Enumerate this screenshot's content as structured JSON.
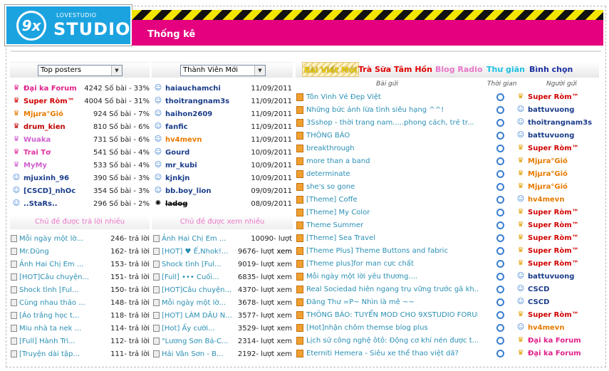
{
  "header": {
    "logo_small": "LOVESTUDIO",
    "logo_big": "STUDIO",
    "logo_mark": "9x",
    "title": "Thống kê"
  },
  "posters": {
    "select": "Top posters",
    "rows": [
      {
        "name": "Đại ka Forum",
        "stat": "4242 Số bài - 33%",
        "color": "#e0218a",
        "icon": "crown-icon"
      },
      {
        "name": "Super Ròm™",
        "stat": "4004 Số bài - 31%",
        "color": "#d10000",
        "icon": "crown-icon"
      },
      {
        "name": "Mjµra°Gió",
        "stat": "924 Số bài - 7%",
        "color": "#e87a00",
        "icon": "crown-icon"
      },
      {
        "name": "drum_kien",
        "stat": "810 Số bài - 6%",
        "color": "#c00000",
        "icon": "crown-icon"
      },
      {
        "name": "Wuaka",
        "stat": "731 Số bài - 6%",
        "color": "#d060d0",
        "icon": "crown-icon"
      },
      {
        "name": "Trai Tơ",
        "stat": "541 Số bài - 4%",
        "color": "#e030a0",
        "icon": "crown-icon"
      },
      {
        "name": "MyMy",
        "stat": "533 Số bài - 4%",
        "color": "#d060d0",
        "icon": "crown-icon"
      },
      {
        "name": "mjuxinh_96",
        "stat": "390 Số bài - 3%",
        "color": "#1a3c8a",
        "icon": "user-icon"
      },
      {
        "name": "[CSCD]_nhOc",
        "stat": "354 Số bài - 3%",
        "color": "#1a3c8a",
        "icon": "user-icon"
      },
      {
        "name": "..StaRs..",
        "stat": "296 Số bài - 2%",
        "color": "#1a3c8a",
        "icon": "user-icon"
      }
    ]
  },
  "members": {
    "select": "Thành Viên Mới",
    "rows": [
      {
        "name": "haiauchamchi",
        "date": "11/09/2011",
        "color": "#1a3c8a"
      },
      {
        "name": "thoitrangnam3s",
        "date": "11/09/2011",
        "color": "#1a3c8a"
      },
      {
        "name": "haihon2609",
        "date": "11/09/2011",
        "color": "#1a3c8a"
      },
      {
        "name": "fanfic",
        "date": "11/09/2011",
        "color": "#1a3c8a"
      },
      {
        "name": "hv4mevn",
        "date": "11/09/2011",
        "color": "#e87a00"
      },
      {
        "name": "Gourd",
        "date": "10/09/2011",
        "color": "#1a3c8a"
      },
      {
        "name": "mr_kubi",
        "date": "10/09/2011",
        "color": "#1a3c8a"
      },
      {
        "name": "kjnkjn",
        "date": "10/09/2011",
        "color": "#1a3c8a"
      },
      {
        "name": "bb.boy_lion",
        "date": "09/09/2011",
        "color": "#1a3c8a"
      },
      {
        "name": "ladog",
        "date": "08/09/2011",
        "color": "#000000"
      }
    ]
  },
  "replied": {
    "title": "Chủ đề được trả lời nhiều",
    "rows": [
      {
        "t": "Mỗi ngày một lờ...",
        "n": "246- trả lời"
      },
      {
        "t": "Mr.Dũng",
        "n": "162- trả lời"
      },
      {
        "t": "Ảnh Hai Chị Em ...",
        "n": "153- trả lời"
      },
      {
        "t": "[HOT]Câu chuyện...",
        "n": "151- trả lời"
      },
      {
        "t": "Shock tình [Ful...",
        "n": "150- trả lời"
      },
      {
        "t": "Cùng nhau thảo ...",
        "n": "148- trả lời"
      },
      {
        "t": "[Áo trắng học t...",
        "n": "118- trả lời"
      },
      {
        "t": "Miu nhà ta nek ...",
        "n": "114- trả lời"
      },
      {
        "t": "[Full] Hành Trì...",
        "n": "112- trả lời"
      },
      {
        "t": "[Truyện dài tập...",
        "n": "111- trả lời"
      }
    ]
  },
  "viewed": {
    "title": "Chủ đề được xem nhiều",
    "rows": [
      {
        "t": "Ảnh Hai Chị Em ...",
        "n": "10090- lượt xem"
      },
      {
        "t": "[HOT] ♥ Ế,Nhok!...",
        "n": "9676- lượt xem"
      },
      {
        "t": "Shock tình [Ful...",
        "n": "9019- lượt xem"
      },
      {
        "t": "[Full] ••• Cuối...",
        "n": "6835- lượt xem"
      },
      {
        "t": "[HOT]Câu chuyện...",
        "n": "4370- lượt xem"
      },
      {
        "t": "Mỗi ngày một lờ...",
        "n": "3678- lượt xem"
      },
      {
        "t": "[HOT] LÀM DÂU N...",
        "n": "3577- lượt xem"
      },
      {
        "t": "[Hot] Ấy cười...",
        "n": "3529- lượt xem"
      },
      {
        "t": "\"Lương Sơn Bá-C...",
        "n": "2314- lượt xem"
      },
      {
        "t": "Hải Vân Sơn - B...",
        "n": "2192- lượt xem"
      }
    ]
  },
  "tabs": [
    {
      "label": "Bài Viết Mới",
      "color": "#f2d000"
    },
    {
      "label": "Trà Sữa Tâm Hồn",
      "color": "#e00000"
    },
    {
      "label": "Blog Radio",
      "color": "#e876c7"
    },
    {
      "label": "Thư giãn",
      "color": "#1ec0e0"
    },
    {
      "label": "Bình chọn",
      "color": "#1a2ea0"
    }
  ],
  "columns": {
    "post": "Bài gửi",
    "time": "Thời gian",
    "poster": "Người gửi"
  },
  "posts": [
    {
      "t": "Tôn Vinh Vẻ Đẹp Việt",
      "u": "Super Ròm™",
      "uc": "#d10000",
      "crown": true
    },
    {
      "t": "Những bức ảnh lừa tình siêu hạng ^^!",
      "u": "battuvuong",
      "uc": "#1a3c8a",
      "crown": false
    },
    {
      "t": "3Sshop - thời trang nam.....phong cách, trẻ tr...",
      "u": "thoitrangnam3s",
      "uc": "#1a3c8a",
      "crown": false
    },
    {
      "t": "THÔNG BÁO",
      "u": "battuvuong",
      "uc": "#1a3c8a",
      "crown": false
    },
    {
      "t": "breakthrough",
      "u": "Super Ròm™",
      "uc": "#d10000",
      "crown": true
    },
    {
      "t": "more than a band",
      "u": "Mjµra°Gió",
      "uc": "#e87a00",
      "crown": true
    },
    {
      "t": "determinate",
      "u": "Mjµra°Gió",
      "uc": "#e87a00",
      "crown": true
    },
    {
      "t": "she's so gone",
      "u": "Mjµra°Gió",
      "uc": "#e87a00",
      "crown": true
    },
    {
      "t": "[Theme] Coffe",
      "u": "hv4mevn",
      "uc": "#e87a00",
      "crown": false
    },
    {
      "t": "[Theme] My Color",
      "u": "Super Ròm™",
      "uc": "#d10000",
      "crown": true
    },
    {
      "t": "Theme Summer",
      "u": "Super Ròm™",
      "uc": "#d10000",
      "crown": true
    },
    {
      "t": "[Theme] Sea Travel",
      "u": "Super Ròm™",
      "uc": "#d10000",
      "crown": true
    },
    {
      "t": "[Theme Plus] Theme Buttons and fabric",
      "u": "Super Ròm™",
      "uc": "#d10000",
      "crown": true
    },
    {
      "t": "[Theme plus]for man cực chất",
      "u": "Super Ròm™",
      "uc": "#d10000",
      "crown": true
    },
    {
      "t": "Mỗi ngày một lời yêu thương....",
      "u": "battuvuong",
      "uc": "#1a3c8a",
      "crown": false
    },
    {
      "t": "Real Sociedad hiên ngang trụ vững trước gã kh...",
      "u": "CSCD",
      "uc": "#1a3c8a",
      "crown": false
    },
    {
      "t": "Đăng Thư =P~ Nhìn là mê ~~",
      "u": "CSCD",
      "uc": "#1a3c8a",
      "crown": false
    },
    {
      "t": "THÔNG BÁO: TUYỂN MOD CHO 9XSTUDIO FORUM",
      "u": "Super Ròm™",
      "uc": "#d10000",
      "crown": true
    },
    {
      "t": "[Hot]nhận chôm themse blog plus",
      "u": "hv4mevn",
      "uc": "#e87a00",
      "crown": false
    },
    {
      "t": "Lịch sử công nghệ ôtô: Động cơ khí nén được t...",
      "u": "Đại ka Forum",
      "uc": "#e0218a",
      "crown": true
    },
    {
      "t": "Eterniti Hemera - Siêu xe thể thao việt dã?",
      "u": "Đại ka Forum",
      "uc": "#e0218a",
      "crown": true
    }
  ]
}
